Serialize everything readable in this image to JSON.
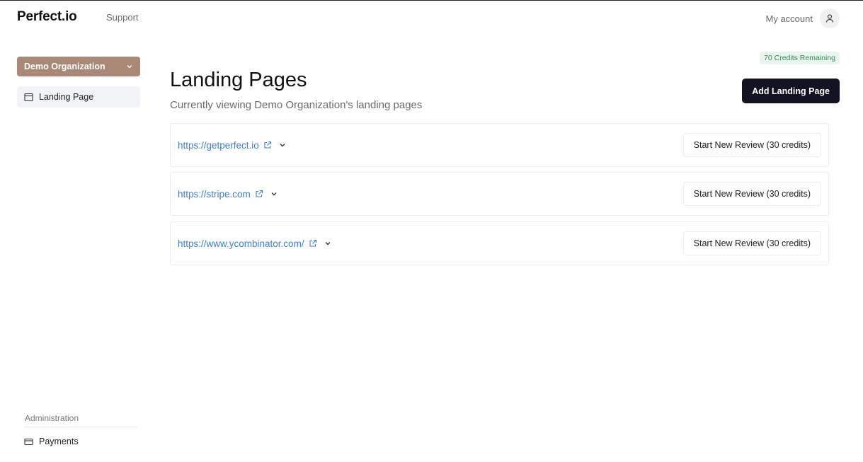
{
  "header": {
    "logo": "Perfect.io",
    "support_label": "Support",
    "account_label": "My account"
  },
  "sidebar": {
    "org_selected": "Demo Organization",
    "items": [
      {
        "label": "Landing Page",
        "icon": "browser-window-icon",
        "active": true
      }
    ],
    "admin_section_label": "Administration",
    "admin_items": [
      {
        "label": "Payments",
        "icon": "credit-card-icon"
      }
    ]
  },
  "main": {
    "credits_badge": "70 Credits Remaining",
    "title": "Landing Pages",
    "subtitle": "Currently viewing Demo Organization's landing pages",
    "add_button_label": "Add Landing Page",
    "rows": [
      {
        "url": "https://getperfect.io",
        "action_label": "Start New Review (30 credits)"
      },
      {
        "url": "https://stripe.com",
        "action_label": "Start New Review (30 credits)"
      },
      {
        "url": "https://www.ycombinator.com/",
        "action_label": "Start New Review (30 credits)"
      }
    ]
  },
  "colors": {
    "org_select_bg": "#a98878",
    "primary_button_bg": "#121220",
    "link": "#3f7fd0",
    "credits_badge_bg": "#e9f6ee",
    "credits_badge_text": "#2f8a55"
  }
}
